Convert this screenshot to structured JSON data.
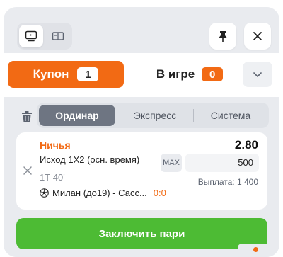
{
  "header": {
    "icons": [
      "tv-icon",
      "ticket-icon",
      "pin-icon",
      "close-icon"
    ]
  },
  "tabs": {
    "coupon_label": "Купон",
    "coupon_count": "1",
    "ingame_label": "В игре",
    "ingame_count": "0"
  },
  "bet_types": {
    "items": [
      "Ординар",
      "Экспресс",
      "Система"
    ],
    "selected": "Ординар"
  },
  "bet": {
    "outcome": "Ничья",
    "odds": "2.80",
    "market": "Исход 1Х2 (осн. время)",
    "period": "1Т 40'",
    "match": "Милан (до19) - Сасс...",
    "score": "0:0",
    "max_label": "MAX",
    "stake": "500",
    "payout": "Выплата: 1 400"
  },
  "actions": {
    "submit_label": "Заключить пари"
  },
  "colors": {
    "accent": "#f26a14",
    "submit": "#4dbb34",
    "segment_active": "#6e7582"
  }
}
